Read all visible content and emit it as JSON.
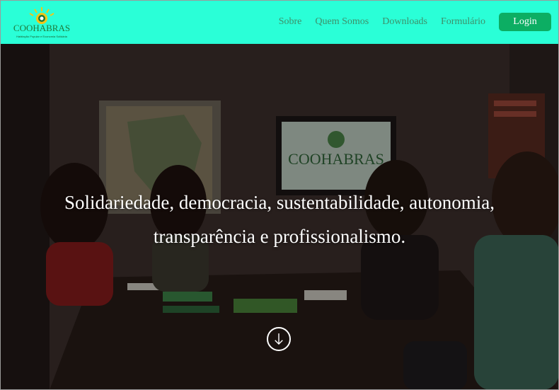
{
  "brand": {
    "name": "COOHABRAS",
    "tagline": "Habitação Popular e Economia Solidária",
    "icon": "coohabras-logo"
  },
  "nav": {
    "items": [
      {
        "label": "Sobre"
      },
      {
        "label": "Quem Somos"
      },
      {
        "label": "Downloads"
      },
      {
        "label": "Formulário"
      }
    ],
    "login_label": "Login"
  },
  "hero": {
    "headline_line1": "Solidariedade, democracia, sustentabilidade, autonomia,",
    "headline_line2": "transparência e profissionalismo.",
    "scroll_icon": "arrow-down-circle-icon"
  },
  "colors": {
    "header_bg": "#2affd7",
    "nav_text": "#3e8f69",
    "login_bg": "#0cae63"
  }
}
